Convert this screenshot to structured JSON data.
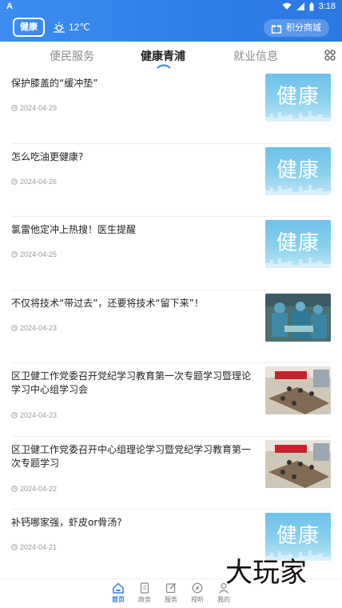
{
  "status": {
    "left": "A",
    "time": "3:18"
  },
  "header": {
    "logo_text": "健康",
    "weather_temp": "12℃",
    "points_button": "积分商城"
  },
  "tabs": [
    {
      "label": "便民服务"
    },
    {
      "label": "健康青浦",
      "active": true
    },
    {
      "label": "就业信息"
    }
  ],
  "thumb_text": "健康",
  "items": [
    {
      "title": "保护膝盖的“缓冲垫”",
      "date": "2024-04-29",
      "thumb": "health"
    },
    {
      "title": "怎么吃油更健康?",
      "date": "2024-04-26",
      "thumb": "health"
    },
    {
      "title": "氯雷他定冲上热搜！医生提醒",
      "date": "2024-04-25",
      "thumb": "health"
    },
    {
      "title": "不仅将技术“带过去”，还要将技术“留下来”！",
      "date": "2024-04-23",
      "thumb": "photo-op"
    },
    {
      "title": "区卫健工作党委召开党纪学习教育第一次专题学习暨理论学习中心组学习会",
      "date": "2024-04-23",
      "thumb": "photo-meet"
    },
    {
      "title": "区卫健工作党委召开中心组理论学习暨党纪学习教育第一次专题学习",
      "date": "2024-04-22",
      "thumb": "photo-meet"
    },
    {
      "title": "补钙哪家强，虾皮or骨汤?",
      "date": "2024-04-21",
      "thumb": "health"
    }
  ],
  "bottom_nav": [
    {
      "label": "首页",
      "active": true,
      "icon": "home-icon"
    },
    {
      "label": "政务",
      "icon": "document-icon"
    },
    {
      "label": "服务",
      "icon": "edit-icon"
    },
    {
      "label": "视听",
      "icon": "compass-icon"
    },
    {
      "label": "我的",
      "icon": "user-icon"
    }
  ],
  "watermark": "大玩家",
  "colors": {
    "brand": "#2f7ee8",
    "thumb_sky": "#8ad0ee"
  }
}
